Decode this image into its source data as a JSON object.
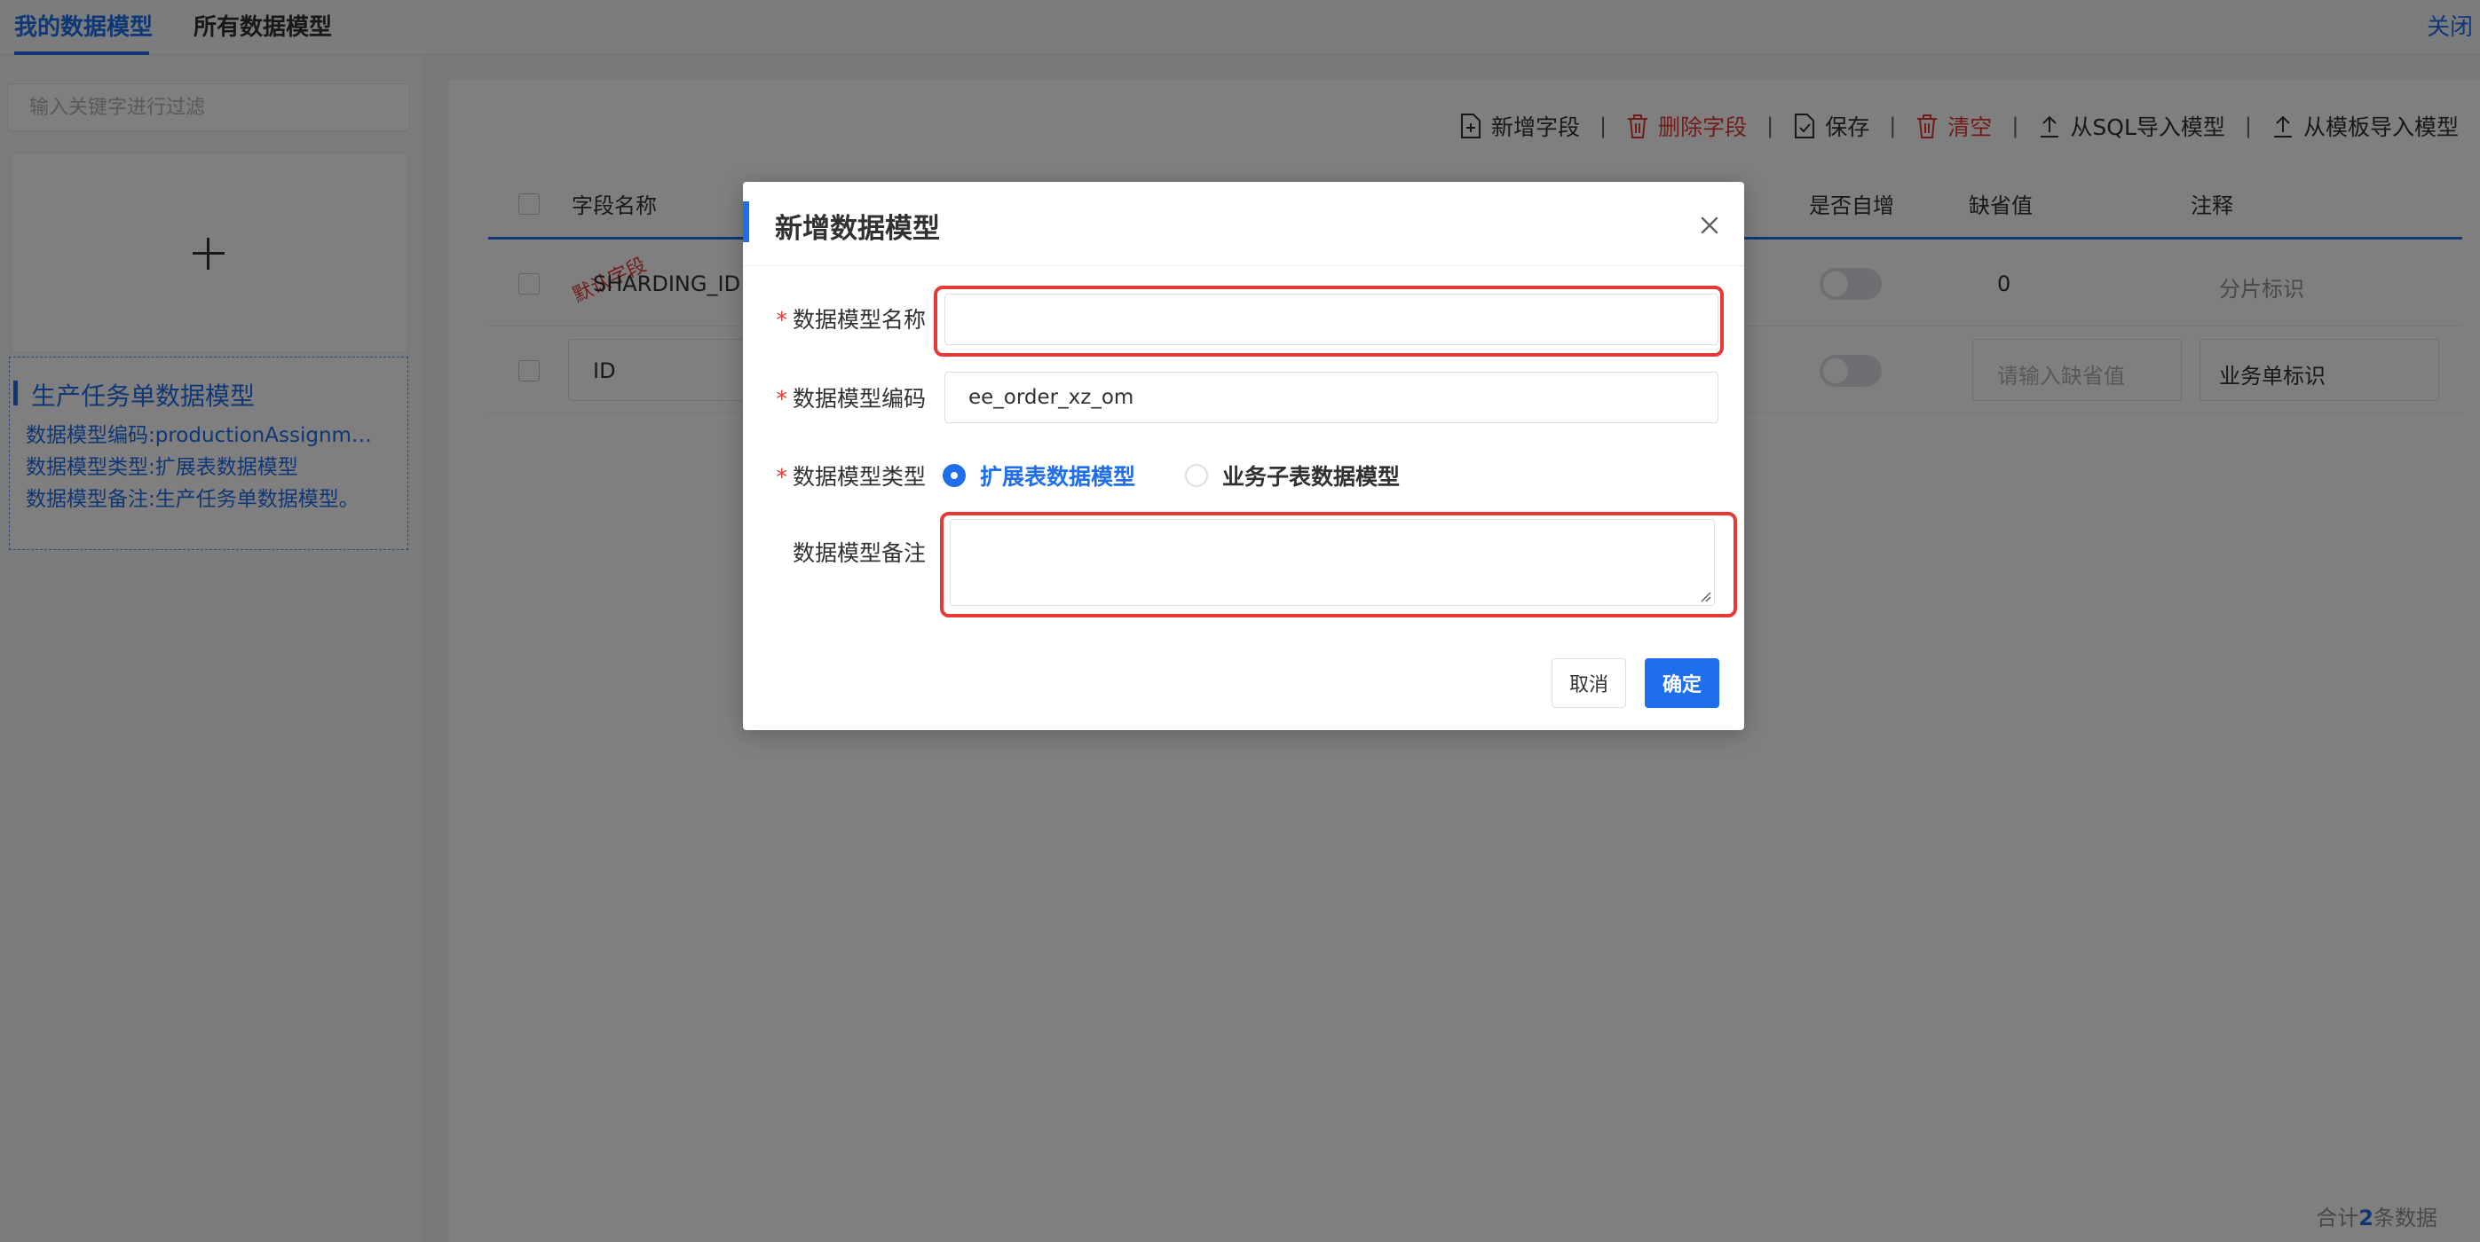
{
  "tabs": {
    "my_models": "我的数据模型",
    "all_models": "所有数据模型",
    "close": "关闭"
  },
  "sidebar": {
    "filter_placeholder": "输入关键字进行过滤",
    "card": {
      "title": "生产任务单数据模型",
      "code": "数据模型编码:productionAssignm…",
      "type": "数据模型类型:扩展表数据模型",
      "note": "数据模型备注:生产任务单数据模型。"
    }
  },
  "toolbar": {
    "add_field": "新增字段",
    "delete_field": "删除字段",
    "save": "保存",
    "clear": "清空",
    "import_sql": "从SQL导入模型",
    "import_template": "从模板导入模型",
    "separator": "|"
  },
  "grid": {
    "headers": {
      "field_name": "字段名称",
      "auto_inc": "是否自增",
      "default": "缺省值",
      "comment": "注释"
    },
    "rows": [
      {
        "name": "SHARDING_ID",
        "stamp": "默认字段",
        "default": "0",
        "comment": "分片标识"
      },
      {
        "name": "ID",
        "default_placeholder": "请输入缺省值",
        "comment": "业务单标识"
      }
    ],
    "footer": {
      "prefix": "合计",
      "count": "2",
      "suffix": "条数据"
    }
  },
  "dialog": {
    "title": "新增数据模型",
    "fields": {
      "name_label": "数据模型名称",
      "name_value": "",
      "code_label": "数据模型编码",
      "code_value": "ee_order_xz_om",
      "type_label": "数据模型类型",
      "type_options": [
        "扩展表数据模型",
        "业务子表数据模型"
      ],
      "note_label": "数据模型备注",
      "note_value": ""
    },
    "required_mark": "*",
    "cancel": "取消",
    "confirm": "确定"
  },
  "colors": {
    "accent": "#1f6feb",
    "danger": "#e53935",
    "highlight": "#e53935"
  }
}
